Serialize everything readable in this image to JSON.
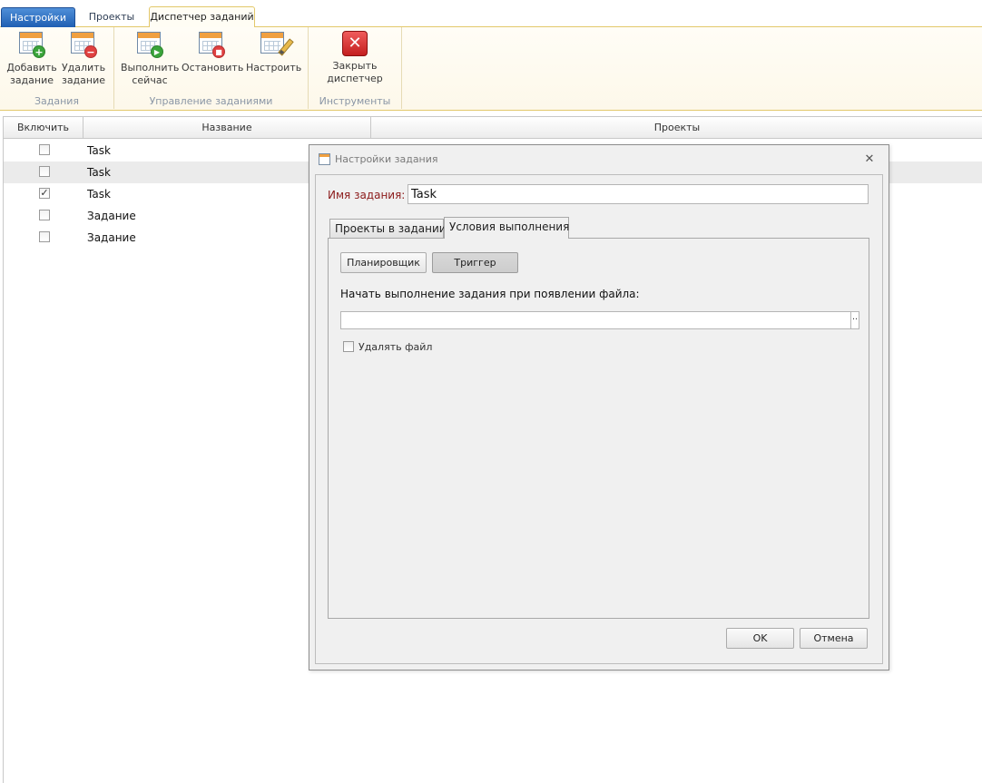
{
  "top_tabs": {
    "settings": "Настройки",
    "projects": "Проекты",
    "task_manager": "Диспетчер заданий"
  },
  "ribbon": {
    "groups": {
      "tasks": "Задания",
      "task_control": "Управление заданиями",
      "tools": "Инструменты"
    },
    "buttons": {
      "add_task": {
        "line1": "Добавить",
        "line2": "задание",
        "icon": "calendar-add-icon"
      },
      "delete_task": {
        "line1": "Удалить",
        "line2": "задание",
        "icon": "calendar-delete-icon"
      },
      "run_now": {
        "line1": "Выполнить",
        "line2": "сейчас",
        "icon": "calendar-run-icon"
      },
      "stop": {
        "line1": "Остановить",
        "icon": "calendar-stop-icon"
      },
      "configure": {
        "line1": "Настроить",
        "icon": "calendar-edit-icon"
      },
      "close_manager": {
        "line1": "Закрыть",
        "line2": "диспетчер",
        "icon": "close-red-icon"
      }
    }
  },
  "grid": {
    "columns": {
      "enable": "Включить",
      "name": "Название",
      "projects": "Проекты"
    },
    "rows": [
      {
        "enabled": false,
        "check": "",
        "name": "Task"
      },
      {
        "enabled": false,
        "check": "",
        "name": "Task"
      },
      {
        "enabled": true,
        "check": "✓",
        "name": "Task"
      },
      {
        "enabled": false,
        "check": "",
        "name": "Задание"
      },
      {
        "enabled": false,
        "check": "",
        "name": "Задание"
      }
    ]
  },
  "dialog": {
    "title": "Настройки задания",
    "close_glyph": "✕",
    "name_label": "Имя задания:",
    "name_value": "Task",
    "tabs": {
      "projects": "Проекты в задании",
      "conditions": "Условия выполнения"
    },
    "mode_buttons": {
      "scheduler": "Планировщик",
      "trigger": "Триггер"
    },
    "trigger_label": "Начать выполнение задания при появлении файла:",
    "file_path": "",
    "browse_glyph": "··",
    "delete_file_label": "Удалять файл",
    "delete_file_checked": false,
    "ok": "OK",
    "cancel": "Отмена"
  },
  "colors": {
    "active_tab_blue": "#1f5fb3",
    "ribbon_border": "#e3c86b",
    "name_label_red": "#8b1a1a",
    "close_red": "#c41f1f"
  }
}
